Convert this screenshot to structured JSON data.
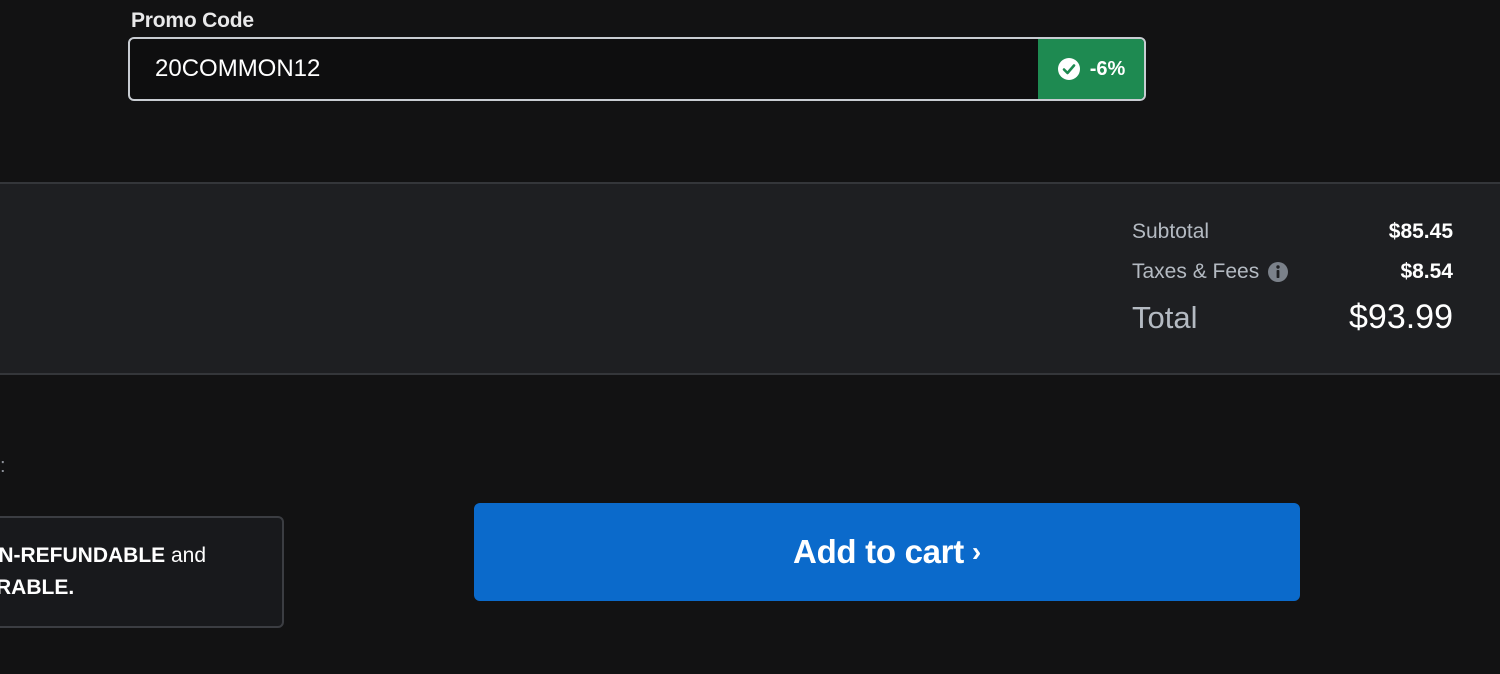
{
  "promo": {
    "label": "Promo Code",
    "value": "20COMMON12",
    "badge_text": "-6%",
    "badge_icon": "check-circle-icon",
    "badge_color": "#1e8a51"
  },
  "summary": {
    "subtotal_label": "Subtotal",
    "subtotal_value": "$85.45",
    "taxes_label": "Taxes & Fees",
    "taxes_icon": "info-icon",
    "taxes_value": "$8.54",
    "total_label": "Total",
    "total_value": "$93.99"
  },
  "notice": {
    "partial_colon": ":",
    "line1_bold": "ON-REFUNDABLE",
    "line1_rest": " and",
    "line2_bold": "ERABLE."
  },
  "cart": {
    "button_label": "Add to cart",
    "chevron": "›",
    "button_color": "#0b6acb"
  }
}
